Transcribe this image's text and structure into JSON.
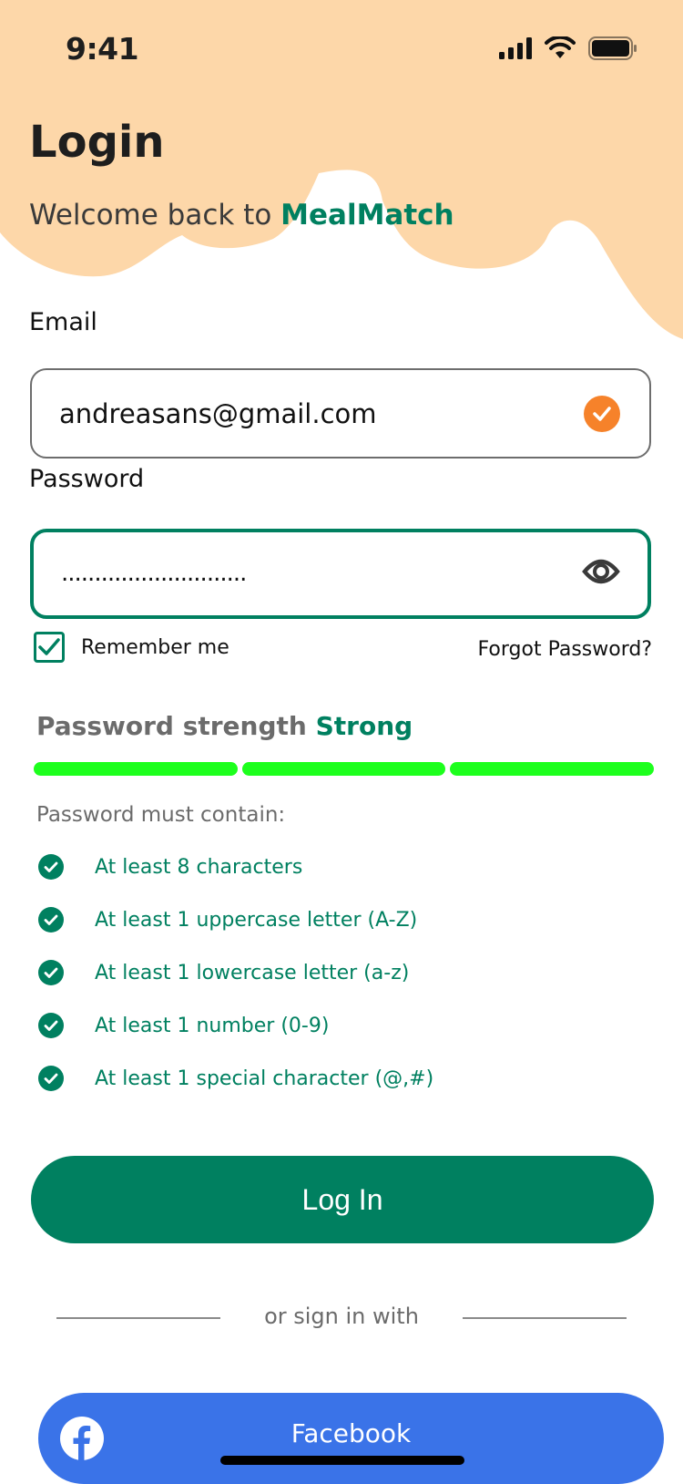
{
  "status_bar": {
    "time": "9:41"
  },
  "header": {
    "title": "Login",
    "welcome_prefix": "Welcome back to ",
    "brand": "MealMatch"
  },
  "email": {
    "label": "Email",
    "value": "andreasans@gmail.com"
  },
  "password": {
    "label": "Password",
    "masked_value": "............................"
  },
  "remember": {
    "label": "Remember me",
    "checked": true
  },
  "forgot_label": "Forgot Password?",
  "strength": {
    "prefix": "Password strength ",
    "level": "Strong",
    "segments_filled": 3,
    "segments_total": 3
  },
  "requirements": {
    "heading": "Password must contain:",
    "items": [
      "At least 8 characters",
      "At least 1 uppercase letter (A-Z)",
      "At least 1 lowercase letter (a-z)",
      "At least 1 number (0-9)",
      "At least 1 special character (@,#)"
    ]
  },
  "login_button": "Log In",
  "divider_text": "or sign in with",
  "facebook_button": "Facebook",
  "colors": {
    "accent": "#008060",
    "blob": "#fdd7a9",
    "success_orange": "#f6822a",
    "strength_bar": "#1dff1d",
    "facebook": "#3a73e8"
  }
}
